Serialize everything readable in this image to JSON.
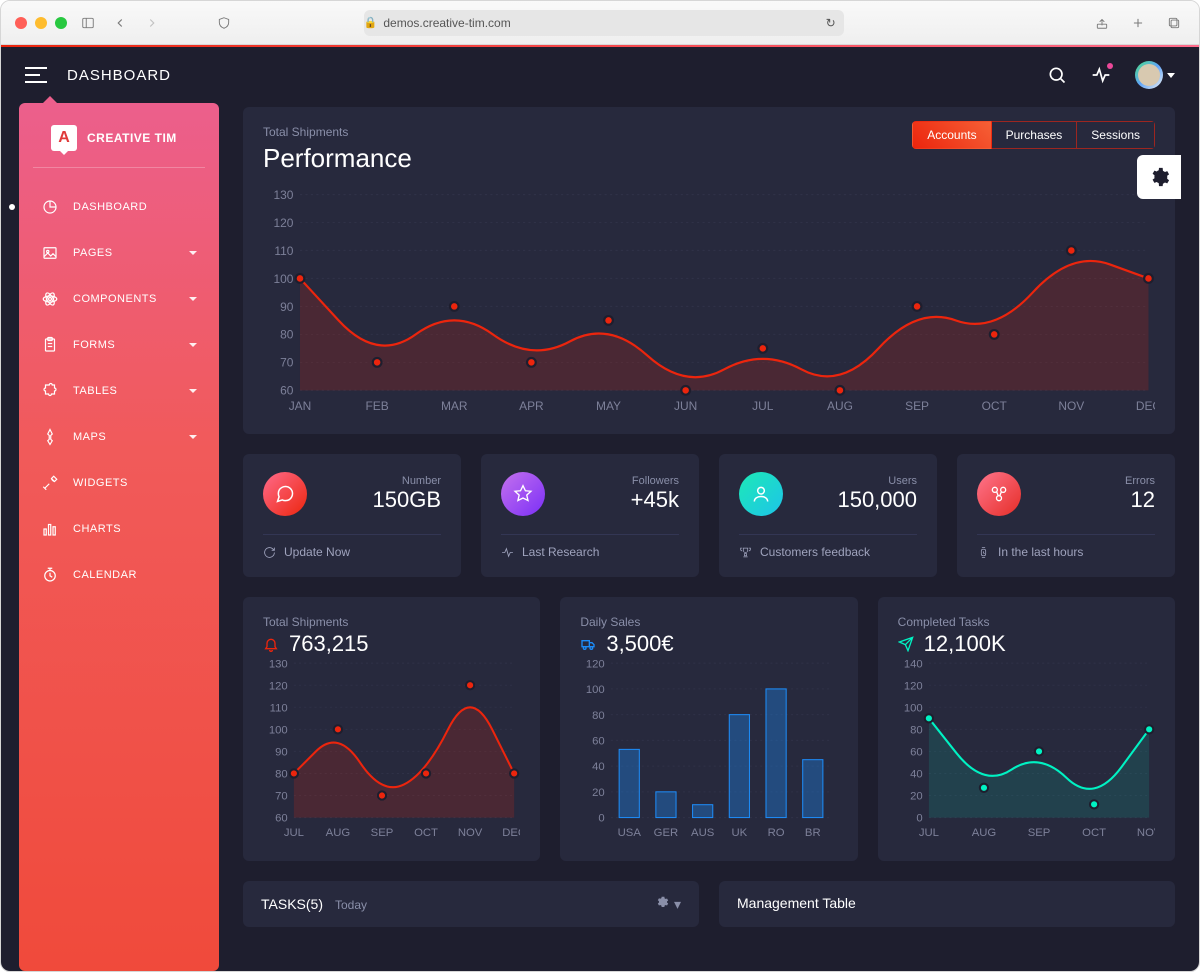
{
  "browser": {
    "url": "demos.creative-tim.com"
  },
  "navbar": {
    "title": "DASHBOARD"
  },
  "sidebar": {
    "brand": "CREATIVE TIM",
    "items": [
      {
        "label": "DASHBOARD",
        "icon": "chart-pie",
        "expandable": false,
        "active": true
      },
      {
        "label": "PAGES",
        "icon": "image",
        "expandable": true
      },
      {
        "label": "COMPONENTS",
        "icon": "atom",
        "expandable": true
      },
      {
        "label": "FORMS",
        "icon": "clipboard",
        "expandable": true
      },
      {
        "label": "TABLES",
        "icon": "puzzle",
        "expandable": true
      },
      {
        "label": "MAPS",
        "icon": "pin",
        "expandable": true
      },
      {
        "label": "WIDGETS",
        "icon": "tools",
        "expandable": false
      },
      {
        "label": "CHARTS",
        "icon": "bars",
        "expandable": false
      },
      {
        "label": "CALENDAR",
        "icon": "clock",
        "expandable": false
      }
    ]
  },
  "performance": {
    "subtitle": "Total Shipments",
    "title": "Performance",
    "tabs": [
      "Accounts",
      "Purchases",
      "Sessions"
    ],
    "active_tab": 0
  },
  "stats": [
    {
      "label": "Number",
      "value": "150GB",
      "footer": "Update Now",
      "icon": "chat",
      "grad": "grad-orange",
      "foot_icon": "refresh"
    },
    {
      "label": "Followers",
      "value": "+45k",
      "footer": "Last Research",
      "icon": "star",
      "grad": "grad-purple",
      "foot_icon": "pulse"
    },
    {
      "label": "Users",
      "value": "150,000",
      "footer": "Customers feedback",
      "icon": "user",
      "grad": "grad-teal",
      "foot_icon": "trophy"
    },
    {
      "label": "Errors",
      "value": "12",
      "footer": "In the last hours",
      "icon": "molecule",
      "grad": "grad-red",
      "foot_icon": "watch"
    }
  ],
  "mini": {
    "shipments": {
      "title": "Total Shipments",
      "value": "763,215"
    },
    "sales": {
      "title": "Daily Sales",
      "value": "3,500€"
    },
    "tasks": {
      "title": "Completed Tasks",
      "value": "12,100K"
    }
  },
  "bottom": {
    "tasks": {
      "title": "TASKS(5)",
      "sub": "Today"
    },
    "mgmt": {
      "title": "Management Table"
    }
  },
  "chart_data": [
    {
      "id": "performance",
      "type": "line",
      "title": "Performance",
      "categories": [
        "JAN",
        "FEB",
        "MAR",
        "APR",
        "MAY",
        "JUN",
        "JUL",
        "AUG",
        "SEP",
        "OCT",
        "NOV",
        "DEC"
      ],
      "values": [
        100,
        70,
        90,
        70,
        85,
        60,
        75,
        60,
        90,
        80,
        110,
        100
      ],
      "ylim": [
        60,
        130
      ],
      "yticks": [
        60,
        70,
        80,
        90,
        100,
        110,
        120,
        130
      ],
      "xlabel": "",
      "ylabel": ""
    },
    {
      "id": "shipments",
      "type": "line",
      "title": "Total Shipments",
      "categories": [
        "JUL",
        "AUG",
        "SEP",
        "OCT",
        "NOV",
        "DEC"
      ],
      "values": [
        80,
        100,
        70,
        80,
        120,
        80
      ],
      "ylim": [
        60,
        130
      ],
      "yticks": [
        60,
        70,
        80,
        90,
        100,
        110,
        120,
        130
      ]
    },
    {
      "id": "sales",
      "type": "bar",
      "title": "Daily Sales",
      "categories": [
        "USA",
        "GER",
        "AUS",
        "UK",
        "RO",
        "BR"
      ],
      "values": [
        53,
        20,
        10,
        80,
        100,
        45
      ],
      "ylim": [
        0,
        120
      ],
      "yticks": [
        0,
        20,
        40,
        60,
        80,
        100,
        120
      ]
    },
    {
      "id": "tasks",
      "type": "line",
      "title": "Completed Tasks",
      "categories": [
        "JUL",
        "AUG",
        "SEP",
        "OCT",
        "NOV"
      ],
      "values": [
        90,
        27,
        60,
        12,
        80
      ],
      "ylim": [
        0,
        140
      ],
      "yticks": [
        0,
        20,
        40,
        60,
        80,
        100,
        120,
        140
      ]
    }
  ]
}
